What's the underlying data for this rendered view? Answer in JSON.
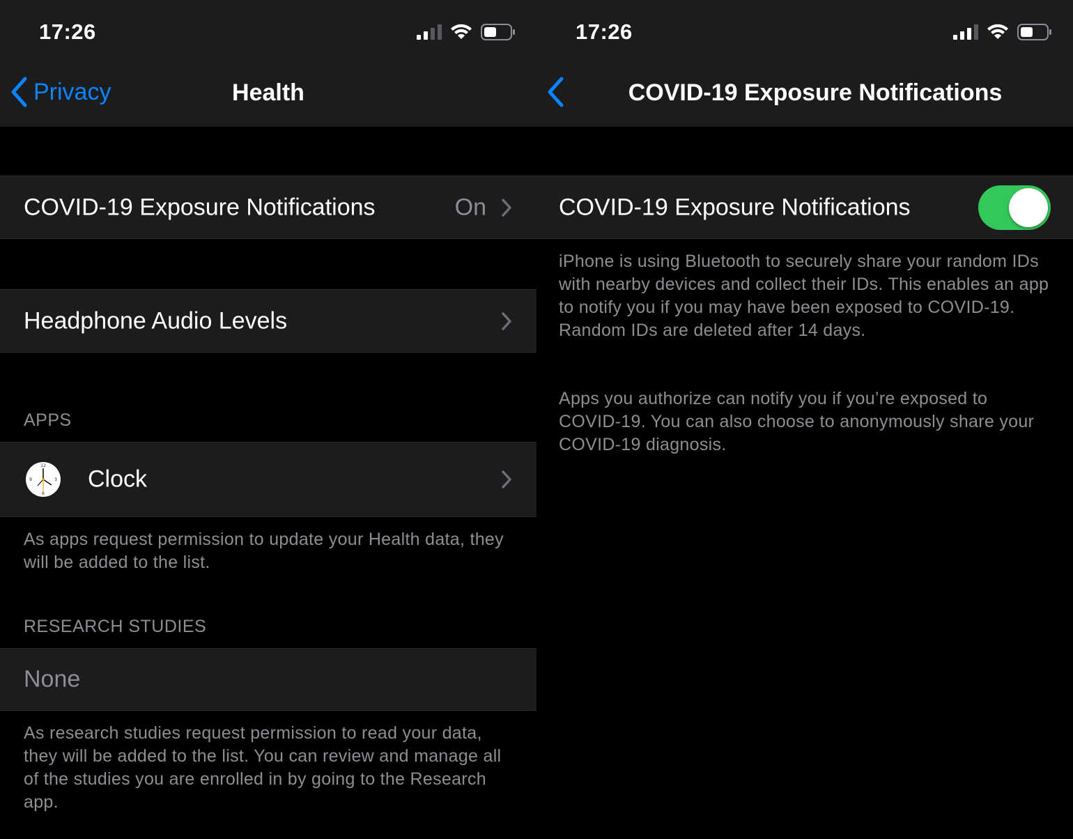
{
  "left": {
    "status_time": "17:26",
    "nav": {
      "back_label": "Privacy",
      "title": "Health"
    },
    "rows": {
      "covid": {
        "label": "COVID-19 Exposure Notifications",
        "value": "On"
      },
      "headphone": {
        "label": "Headphone Audio Levels"
      }
    },
    "apps": {
      "header": "APPS",
      "items": [
        {
          "label": "Clock"
        }
      ],
      "footer": "As apps request permission to update your Health data, they will be added to the list."
    },
    "research": {
      "header": "RESEARCH STUDIES",
      "none_label": "None",
      "footer": "As research studies request permission to read your data, they will be added to the list. You can review and manage all of the studies you are enrolled in by going to the Research app."
    }
  },
  "right": {
    "status_time": "17:26",
    "nav": {
      "title": "COVID-19 Exposure Notifications"
    },
    "toggle_row": {
      "label": "COVID-19 Exposure Notifications",
      "on": true
    },
    "description": "iPhone is using Bluetooth to securely share your random IDs with nearby devices and collect their IDs. This enables an app to notify you if you may have been exposed to COVID-19. Random IDs are deleted after 14 days.",
    "description2": "Apps you authorize can notify you if you’re exposed to COVID-19. You can also choose to anonymously share your COVID-19 diagnosis."
  },
  "colors": {
    "accent": "#0a84ff",
    "toggle_on": "#34c759",
    "cell_bg": "#1c1c1e",
    "secondary_text": "#8d8d93"
  },
  "icons": [
    "signal-icon",
    "wifi-icon",
    "battery-icon",
    "back-chevron-icon",
    "disclosure-chevron-icon",
    "clock-app-icon"
  ]
}
